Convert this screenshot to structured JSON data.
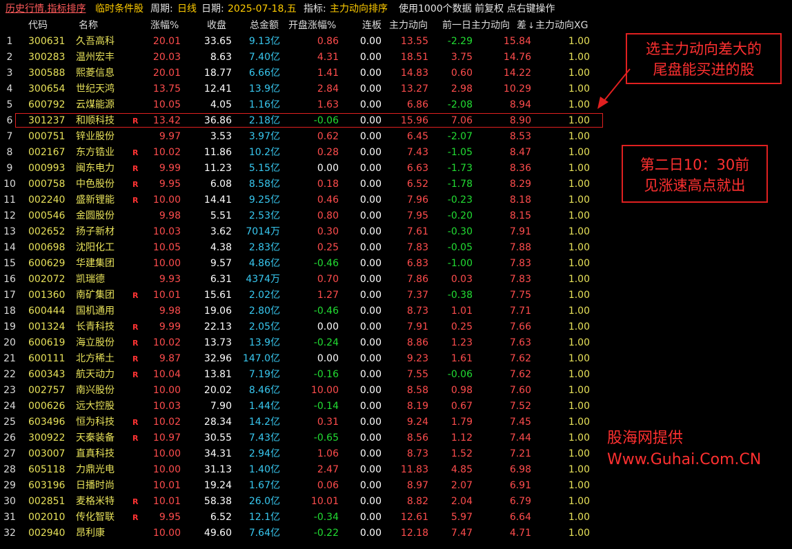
{
  "topbar": {
    "title": "历史行情.指标排序",
    "condition": "临时条件股",
    "period_label": "周期:",
    "period_value": "日线",
    "date_label": "日期:",
    "date_value": "2025-07-18,五",
    "indicator_label": "指标:",
    "indicator_value": "主力动向排序",
    "info": "使用1000个数据 前复权 点右键操作"
  },
  "columns": [
    "代码",
    "名称",
    "涨幅%",
    "收盘",
    "总金额",
    "开盘涨幅%",
    "连板",
    "主力动向",
    "前一日主力动向",
    "差",
    "主力动向XG"
  ],
  "sort_indicator": "↓",
  "rows": [
    {
      "idx": "1",
      "code": "300631",
      "name": "久吾高科",
      "r": "",
      "chg": "20.01",
      "close": "33.65",
      "amt": "9.13亿",
      "open": "0.86",
      "open_color": "red",
      "lb": "0.00",
      "zl": "13.55",
      "prev": "-2.29",
      "prev_color": "green",
      "diff": "15.84",
      "xg": "1.00"
    },
    {
      "idx": "2",
      "code": "300283",
      "name": "温州宏丰",
      "r": "",
      "chg": "20.03",
      "close": "8.63",
      "amt": "7.40亿",
      "open": "4.31",
      "open_color": "red",
      "lb": "0.00",
      "zl": "18.51",
      "prev": "3.75",
      "prev_color": "red",
      "diff": "14.76",
      "xg": "1.00"
    },
    {
      "idx": "3",
      "code": "300588",
      "name": "熙菱信息",
      "r": "",
      "chg": "20.01",
      "close": "18.77",
      "amt": "6.66亿",
      "open": "1.41",
      "open_color": "red",
      "lb": "0.00",
      "zl": "14.83",
      "prev": "0.60",
      "prev_color": "red",
      "diff": "14.22",
      "xg": "1.00"
    },
    {
      "idx": "4",
      "code": "300654",
      "name": "世纪天鸿",
      "r": "",
      "chg": "13.75",
      "close": "12.41",
      "amt": "13.9亿",
      "open": "2.84",
      "open_color": "red",
      "lb": "0.00",
      "zl": "13.27",
      "prev": "2.98",
      "prev_color": "red",
      "diff": "10.29",
      "xg": "1.00"
    },
    {
      "idx": "5",
      "code": "600792",
      "name": "云煤能源",
      "r": "",
      "chg": "10.05",
      "close": "4.05",
      "amt": "1.16亿",
      "open": "1.63",
      "open_color": "red",
      "lb": "0.00",
      "zl": "6.86",
      "prev": "-2.08",
      "prev_color": "green",
      "diff": "8.94",
      "xg": "1.00"
    },
    {
      "idx": "6",
      "code": "301237",
      "name": "和顺科技",
      "r": "R",
      "chg": "13.42",
      "close": "36.86",
      "amt": "2.18亿",
      "open": "-0.06",
      "open_color": "green",
      "lb": "0.00",
      "zl": "15.96",
      "prev": "7.06",
      "prev_color": "red",
      "diff": "8.90",
      "xg": "1.00"
    },
    {
      "idx": "7",
      "code": "000751",
      "name": "锌业股份",
      "r": "",
      "chg": "9.97",
      "close": "3.53",
      "amt": "3.97亿",
      "open": "0.62",
      "open_color": "red",
      "lb": "0.00",
      "zl": "6.45",
      "prev": "-2.07",
      "prev_color": "green",
      "diff": "8.53",
      "xg": "1.00"
    },
    {
      "idx": "8",
      "code": "002167",
      "name": "东方锆业",
      "r": "R",
      "chg": "10.02",
      "close": "11.86",
      "amt": "10.2亿",
      "open": "0.28",
      "open_color": "red",
      "lb": "0.00",
      "zl": "7.43",
      "prev": "-1.05",
      "prev_color": "green",
      "diff": "8.47",
      "xg": "1.00"
    },
    {
      "idx": "9",
      "code": "000993",
      "name": "闽东电力",
      "r": "R",
      "chg": "9.99",
      "close": "11.23",
      "amt": "5.15亿",
      "open": "0.00",
      "open_color": "white",
      "lb": "0.00",
      "zl": "6.63",
      "prev": "-1.73",
      "prev_color": "green",
      "diff": "8.36",
      "xg": "1.00"
    },
    {
      "idx": "10",
      "code": "000758",
      "name": "中色股份",
      "r": "R",
      "chg": "9.95",
      "close": "6.08",
      "amt": "8.58亿",
      "open": "0.18",
      "open_color": "red",
      "lb": "0.00",
      "zl": "6.52",
      "prev": "-1.78",
      "prev_color": "green",
      "diff": "8.29",
      "xg": "1.00"
    },
    {
      "idx": "11",
      "code": "002240",
      "name": "盛新锂能",
      "r": "R",
      "chg": "10.00",
      "close": "14.41",
      "amt": "9.25亿",
      "open": "0.46",
      "open_color": "red",
      "lb": "0.00",
      "zl": "7.96",
      "prev": "-0.23",
      "prev_color": "green",
      "diff": "8.18",
      "xg": "1.00"
    },
    {
      "idx": "12",
      "code": "000546",
      "name": "金圆股份",
      "r": "",
      "chg": "9.98",
      "close": "5.51",
      "amt": "2.53亿",
      "open": "0.80",
      "open_color": "red",
      "lb": "0.00",
      "zl": "7.95",
      "prev": "-0.20",
      "prev_color": "green",
      "diff": "8.15",
      "xg": "1.00"
    },
    {
      "idx": "13",
      "code": "002652",
      "name": "扬子新材",
      "r": "",
      "chg": "10.03",
      "close": "3.62",
      "amt": "7014万",
      "open": "0.30",
      "open_color": "red",
      "lb": "0.00",
      "zl": "7.61",
      "prev": "-0.30",
      "prev_color": "green",
      "diff": "7.91",
      "xg": "1.00"
    },
    {
      "idx": "14",
      "code": "000698",
      "name": "沈阳化工",
      "r": "",
      "chg": "10.05",
      "close": "4.38",
      "amt": "2.83亿",
      "open": "0.25",
      "open_color": "red",
      "lb": "0.00",
      "zl": "7.83",
      "prev": "-0.05",
      "prev_color": "green",
      "diff": "7.88",
      "xg": "1.00"
    },
    {
      "idx": "15",
      "code": "600629",
      "name": "华建集团",
      "r": "",
      "chg": "10.00",
      "close": "9.57",
      "amt": "4.86亿",
      "open": "-0.46",
      "open_color": "green",
      "lb": "0.00",
      "zl": "6.83",
      "prev": "-1.00",
      "prev_color": "green",
      "diff": "7.83",
      "xg": "1.00"
    },
    {
      "idx": "16",
      "code": "002072",
      "name": "凯瑞德",
      "r": "",
      "chg": "9.93",
      "close": "6.31",
      "amt": "4374万",
      "open": "0.70",
      "open_color": "red",
      "lb": "0.00",
      "zl": "7.86",
      "prev": "0.03",
      "prev_color": "red",
      "diff": "7.83",
      "xg": "1.00"
    },
    {
      "idx": "17",
      "code": "001360",
      "name": "南矿集团",
      "r": "R",
      "chg": "10.01",
      "close": "15.61",
      "amt": "2.02亿",
      "open": "1.27",
      "open_color": "red",
      "lb": "0.00",
      "zl": "7.37",
      "prev": "-0.38",
      "prev_color": "green",
      "diff": "7.75",
      "xg": "1.00"
    },
    {
      "idx": "18",
      "code": "600444",
      "name": "国机通用",
      "r": "",
      "chg": "9.98",
      "close": "19.06",
      "amt": "2.80亿",
      "open": "-0.46",
      "open_color": "green",
      "lb": "0.00",
      "zl": "8.73",
      "prev": "1.01",
      "prev_color": "red",
      "diff": "7.71",
      "xg": "1.00"
    },
    {
      "idx": "19",
      "code": "001324",
      "name": "长青科技",
      "r": "R",
      "chg": "9.99",
      "close": "22.13",
      "amt": "2.05亿",
      "open": "0.00",
      "open_color": "white",
      "lb": "0.00",
      "zl": "7.91",
      "prev": "0.25",
      "prev_color": "red",
      "diff": "7.66",
      "xg": "1.00"
    },
    {
      "idx": "20",
      "code": "600619",
      "name": "海立股份",
      "r": "R",
      "chg": "10.02",
      "close": "13.73",
      "amt": "13.9亿",
      "open": "-0.24",
      "open_color": "green",
      "lb": "0.00",
      "zl": "8.86",
      "prev": "1.23",
      "prev_color": "red",
      "diff": "7.63",
      "xg": "1.00"
    },
    {
      "idx": "21",
      "code": "600111",
      "name": "北方稀土",
      "r": "R",
      "chg": "9.87",
      "close": "32.96",
      "amt": "147.0亿",
      "open": "0.00",
      "open_color": "white",
      "lb": "0.00",
      "zl": "9.23",
      "prev": "1.61",
      "prev_color": "red",
      "diff": "7.62",
      "xg": "1.00"
    },
    {
      "idx": "22",
      "code": "600343",
      "name": "航天动力",
      "r": "R",
      "chg": "10.04",
      "close": "13.81",
      "amt": "7.19亿",
      "open": "-0.16",
      "open_color": "green",
      "lb": "0.00",
      "zl": "7.55",
      "prev": "-0.06",
      "prev_color": "green",
      "diff": "7.62",
      "xg": "1.00"
    },
    {
      "idx": "23",
      "code": "002757",
      "name": "南兴股份",
      "r": "",
      "chg": "10.00",
      "close": "20.02",
      "amt": "8.46亿",
      "open": "10.00",
      "open_color": "red",
      "lb": "0.00",
      "zl": "8.58",
      "prev": "0.98",
      "prev_color": "red",
      "diff": "7.60",
      "xg": "1.00"
    },
    {
      "idx": "24",
      "code": "000626",
      "name": "远大控股",
      "r": "",
      "chg": "10.03",
      "close": "7.90",
      "amt": "1.44亿",
      "open": "-0.14",
      "open_color": "green",
      "lb": "0.00",
      "zl": "8.19",
      "prev": "0.67",
      "prev_color": "red",
      "diff": "7.52",
      "xg": "1.00"
    },
    {
      "idx": "25",
      "code": "603496",
      "name": "恒为科技",
      "r": "R",
      "chg": "10.02",
      "close": "28.34",
      "amt": "14.2亿",
      "open": "0.31",
      "open_color": "red",
      "lb": "0.00",
      "zl": "9.24",
      "prev": "1.79",
      "prev_color": "red",
      "diff": "7.45",
      "xg": "1.00"
    },
    {
      "idx": "26",
      "code": "300922",
      "name": "天秦装备",
      "r": "R",
      "chg": "10.97",
      "close": "30.55",
      "amt": "7.43亿",
      "open": "-0.65",
      "open_color": "green",
      "lb": "0.00",
      "zl": "8.56",
      "prev": "1.12",
      "prev_color": "red",
      "diff": "7.44",
      "xg": "1.00"
    },
    {
      "idx": "27",
      "code": "003007",
      "name": "直真科技",
      "r": "",
      "chg": "10.00",
      "close": "34.31",
      "amt": "2.94亿",
      "open": "1.06",
      "open_color": "red",
      "lb": "0.00",
      "zl": "8.73",
      "prev": "1.52",
      "prev_color": "red",
      "diff": "7.21",
      "xg": "1.00"
    },
    {
      "idx": "28",
      "code": "605118",
      "name": "力鼎光电",
      "r": "",
      "chg": "10.00",
      "close": "31.13",
      "amt": "1.40亿",
      "open": "2.47",
      "open_color": "red",
      "lb": "0.00",
      "zl": "11.83",
      "prev": "4.85",
      "prev_color": "red",
      "diff": "6.98",
      "xg": "1.00"
    },
    {
      "idx": "29",
      "code": "603196",
      "name": "日播时尚",
      "r": "",
      "chg": "10.01",
      "close": "19.24",
      "amt": "1.67亿",
      "open": "0.06",
      "open_color": "red",
      "lb": "0.00",
      "zl": "8.97",
      "prev": "2.07",
      "prev_color": "red",
      "diff": "6.91",
      "xg": "1.00"
    },
    {
      "idx": "30",
      "code": "002851",
      "name": "麦格米特",
      "r": "R",
      "chg": "10.01",
      "close": "58.38",
      "amt": "26.0亿",
      "open": "10.01",
      "open_color": "red",
      "lb": "0.00",
      "zl": "8.82",
      "prev": "2.04",
      "prev_color": "red",
      "diff": "6.79",
      "xg": "1.00"
    },
    {
      "idx": "31",
      "code": "002010",
      "name": "传化智联",
      "r": "R",
      "chg": "9.95",
      "close": "6.52",
      "amt": "12.1亿",
      "open": "-0.34",
      "open_color": "green",
      "lb": "0.00",
      "zl": "12.61",
      "prev": "5.97",
      "prev_color": "red",
      "diff": "6.64",
      "xg": "1.00"
    },
    {
      "idx": "32",
      "code": "002940",
      "name": "昂利康",
      "r": "",
      "chg": "10.00",
      "close": "49.60",
      "amt": "7.64亿",
      "open": "-0.22",
      "open_color": "green",
      "lb": "0.00",
      "zl": "12.18",
      "prev": "7.47",
      "prev_color": "red",
      "diff": "4.71",
      "xg": "1.00"
    }
  ],
  "annotations": {
    "note1_line1": "选主力动向差大的",
    "note1_line2": "尾盘能买进的股",
    "note2_line1": "第二日10：30前",
    "note2_line2": "见涨速高点就出",
    "credit_line1": "股海网提供",
    "credit_line2": "Www.Guhai.Com.CN"
  },
  "colors": {
    "up": "#ff4d4d",
    "down": "#22dd33",
    "code_name": "#e8e25a",
    "amount": "#38c8f0",
    "annotation": "#ff3030"
  }
}
